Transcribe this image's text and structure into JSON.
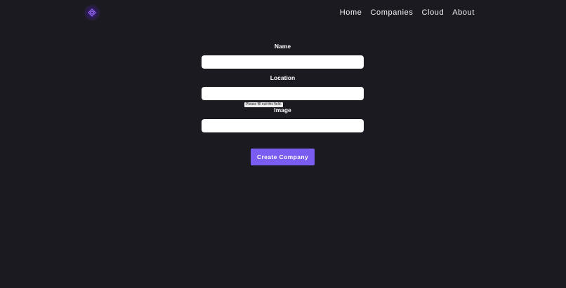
{
  "header": {
    "logo_icon": "swirl-logo-icon",
    "nav": [
      {
        "label": "Home"
      },
      {
        "label": "Companies"
      },
      {
        "label": "Cloud"
      },
      {
        "label": "About"
      }
    ]
  },
  "form": {
    "fields": [
      {
        "label": "Name",
        "value": ""
      },
      {
        "label": "Location",
        "value": ""
      },
      {
        "label": "Image",
        "value": ""
      }
    ],
    "validation_tooltip": "Please fill out this field.",
    "submit_label": "Create Company"
  },
  "colors": {
    "background": "#1c1a21",
    "accent": "#7a5cf0",
    "logo": "#8b5cf6"
  }
}
